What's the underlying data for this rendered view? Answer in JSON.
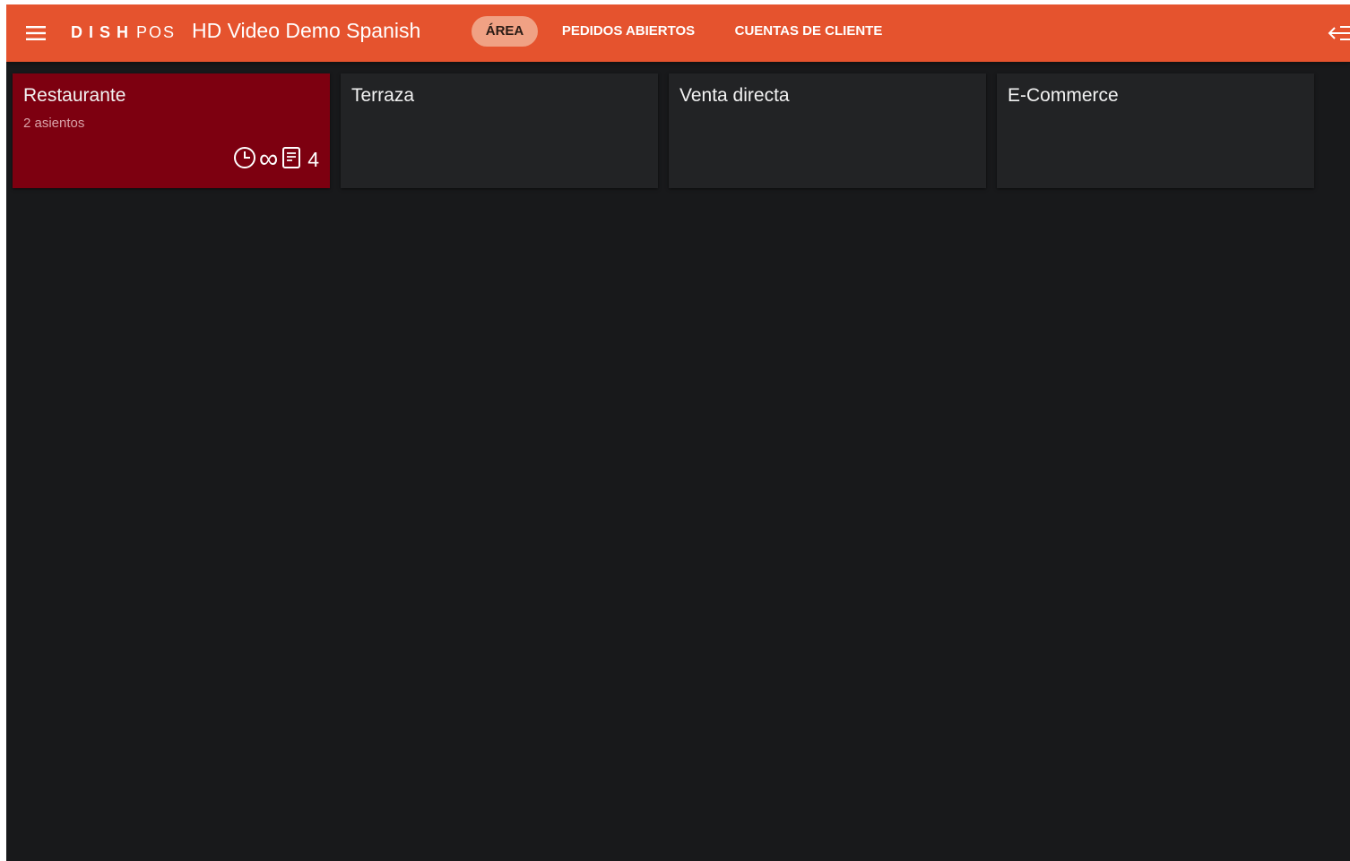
{
  "header": {
    "brand_dish": "DISH",
    "brand_pos": "POS",
    "venue_title": "HD Video Demo Spanish",
    "tabs": [
      {
        "label": "ÁREA",
        "active": true
      },
      {
        "label": "PEDIDOS ABIERTOS",
        "active": false
      },
      {
        "label": "CUENTAS DE CLIENTE",
        "active": false
      }
    ],
    "icons": {
      "menu": "hamburger-menu-icon",
      "logout": "logout-arrow-icon"
    }
  },
  "areas": [
    {
      "name": "Restaurante",
      "subtitle": "2 asientos",
      "active": true,
      "time_limit": "∞",
      "orders": "4"
    },
    {
      "name": "Terraza",
      "active": false
    },
    {
      "name": "Venta directa",
      "active": false
    },
    {
      "name": "E-Commerce",
      "active": false
    }
  ],
  "colors": {
    "header": "#e5532e",
    "active_tab": "#f0a184",
    "background": "#18191b",
    "card": "#222325",
    "active_card": "#7d0010"
  }
}
